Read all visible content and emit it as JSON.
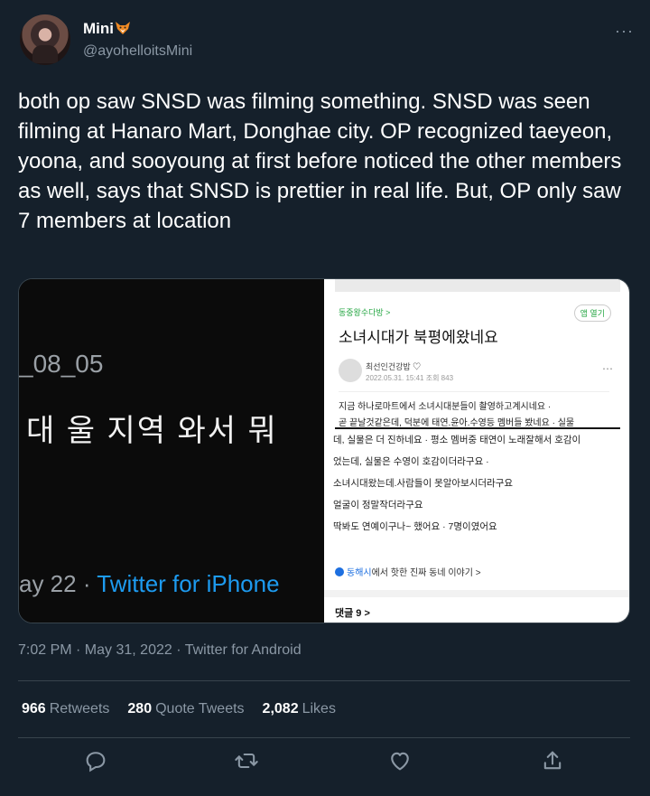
{
  "user": {
    "display_name": "Mini",
    "emoji_icon": "fox-icon",
    "handle": "@ayohelloitsMini"
  },
  "tweet": {
    "text": "both op saw SNSD was filming something. SNSD was seen filming at Hanaro Mart, Donghae city. OP recognized taeyeon, yoona, and sooyoung at first before noticed the other members as well, says that SNSD is prettier in real life. But, OP only saw 7 members at location",
    "timestamp": "7:02 PM · May 31, 2022 · Twitter for Android"
  },
  "media": {
    "left": {
      "date_fragment": "_08_05",
      "korean_text": "대 울 지역 와서 뭐 ",
      "footer_prefix": "ay 22 · ",
      "footer_link": "Twitter for iPhone"
    },
    "right": {
      "cafe_name": "동중왕수다방 >",
      "app_button": "앱 열기",
      "title": "소녀시대가 북평에왔네요",
      "author": "최선인건강밥 ♡",
      "meta": "2022.05.31. 15:41 조회 843",
      "top_lines": [
        "지금 하나로마트에서 소녀시대분들이 촬영하고계시네요 ·",
        "곧 끝날것같은데, 덕분에 태연.윤아.수영등 멤버들 봤네요 · 실물"
      ],
      "body_lines": [
        "데, 실물은 더 진하네요 · 평소 멤버중 태연이 노래잘해서 호감이",
        "었는데, 실물은 수영이 호감이더라구요 ·",
        "소녀시대왔는데.사람들이 못알아보시더라구요",
        "얼굴이 정말작더라구요",
        "딱봐도 연예이구나~ 했어요 · 7명이였어요"
      ],
      "link_highlight": "동해시",
      "link_rest": "에서 핫한 진짜 동네 이야기 >",
      "comments": "댓글 9 >"
    }
  },
  "stats": {
    "retweets_count": "966",
    "retweets_label": "Retweets",
    "quotes_count": "280",
    "quotes_label": "Quote Tweets",
    "likes_count": "2,082",
    "likes_label": "Likes"
  },
  "actions": [
    "reply-icon",
    "retweet-icon",
    "like-icon",
    "share-icon"
  ],
  "colors": {
    "background": "#15202b",
    "muted": "#8b98a5",
    "accent": "#1d9bf0",
    "divider": "#38444d"
  }
}
